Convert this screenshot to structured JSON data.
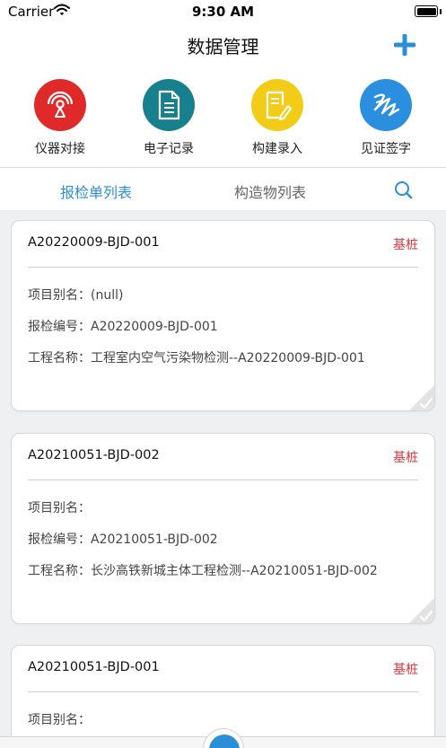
{
  "status_bar": {
    "carrier": "Carrier",
    "time": "9:30 AM"
  },
  "header": {
    "title": "数据管理"
  },
  "shortcuts": [
    {
      "label": "仪器对接",
      "color": "#e02a2a"
    },
    {
      "label": "电子记录",
      "color": "#17808f"
    },
    {
      "label": "构建录入",
      "color": "#f3cc17"
    },
    {
      "label": "见证签字",
      "color": "#2b8fe0"
    }
  ],
  "tabs": [
    {
      "label": "报检单列表",
      "active": true
    },
    {
      "label": "构造物列表",
      "active": false
    }
  ],
  "colors": {
    "accent": "#2a8fd6",
    "tag": "#d9363e"
  },
  "cards": [
    {
      "code": "A20220009-BJD-001",
      "tag": "基桩",
      "alias_label": "项目别名：",
      "alias_value": "(null)",
      "number_label": "报检编号：",
      "number_value": "A20220009-BJD-001",
      "project_label": "工程名称：",
      "project_value": "工程室内空气污染物检测--A20220009-BJD-001"
    },
    {
      "code": "A20210051-BJD-002",
      "tag": "基桩",
      "alias_label": "项目别名：",
      "alias_value": "",
      "number_label": "报检编号：",
      "number_value": "A20210051-BJD-002",
      "project_label": "工程名称：",
      "project_value": "长沙高铁新城主体工程检测--A20210051-BJD-002"
    },
    {
      "code": "A20210051-BJD-001",
      "tag": "基桩",
      "alias_label": "项目别名：",
      "alias_value": ""
    }
  ]
}
